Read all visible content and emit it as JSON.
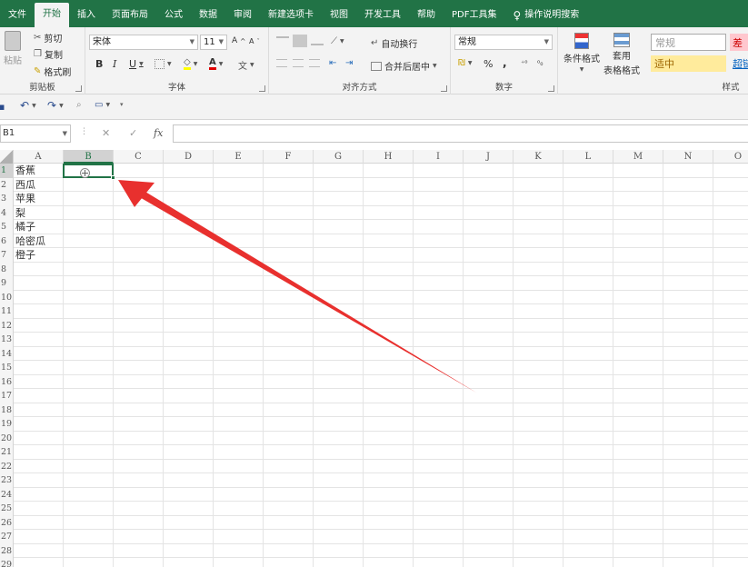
{
  "menu": {
    "tabs": [
      "文件",
      "开始",
      "插入",
      "页面布局",
      "公式",
      "数据",
      "审阅",
      "新建选项卡",
      "视图",
      "开发工具",
      "帮助",
      "PDF工具集"
    ],
    "active_tab": "开始",
    "search_label": "操作说明搜索"
  },
  "ribbon": {
    "clipboard": {
      "paste": "粘贴",
      "cut": "剪切",
      "copy": "复制",
      "format_painter": "格式刷",
      "label": "剪贴板"
    },
    "font": {
      "name": "宋体",
      "size": "11",
      "bold": "B",
      "italic": "I",
      "underline": "U",
      "label": "字体"
    },
    "alignment": {
      "wrap": "自动换行",
      "merge": "合并后居中",
      "label": "对齐方式"
    },
    "number": {
      "format": "常规",
      "percent": "%",
      "comma": ",",
      "label": "数字"
    },
    "styles": {
      "conditional": "条件格式",
      "table_line1": "套用",
      "table_line2": "表格格式",
      "normal": "常规",
      "bad": "差",
      "neutral": "适中",
      "hyperlink": "超链",
      "label": "样式"
    }
  },
  "formula_bar": {
    "name_box": "B1",
    "cancel": "✕",
    "enter": "✓",
    "fx": "fx",
    "value": ""
  },
  "sheet": {
    "columns": [
      "A",
      "B",
      "C",
      "D",
      "E",
      "F",
      "G",
      "H",
      "I",
      "J",
      "K",
      "L",
      "M",
      "N",
      "O"
    ],
    "selected_column": "B",
    "row_numbers": [
      "1",
      "2",
      "3",
      "4",
      "5",
      "6",
      "7",
      "8",
      "9",
      "10",
      "11",
      "12",
      "13",
      "14",
      "15",
      "16",
      "17",
      "18",
      "19",
      "20",
      "21",
      "22",
      "23",
      "24",
      "25",
      "26",
      "27",
      "28",
      "29"
    ],
    "selected_row": "1",
    "column_a": [
      "香蕉",
      "西瓜",
      "苹果",
      "梨",
      "橘子",
      "哈密瓜",
      "橙子"
    ]
  },
  "colors": {
    "accent": "#217346",
    "arrow": "#e8302e"
  }
}
